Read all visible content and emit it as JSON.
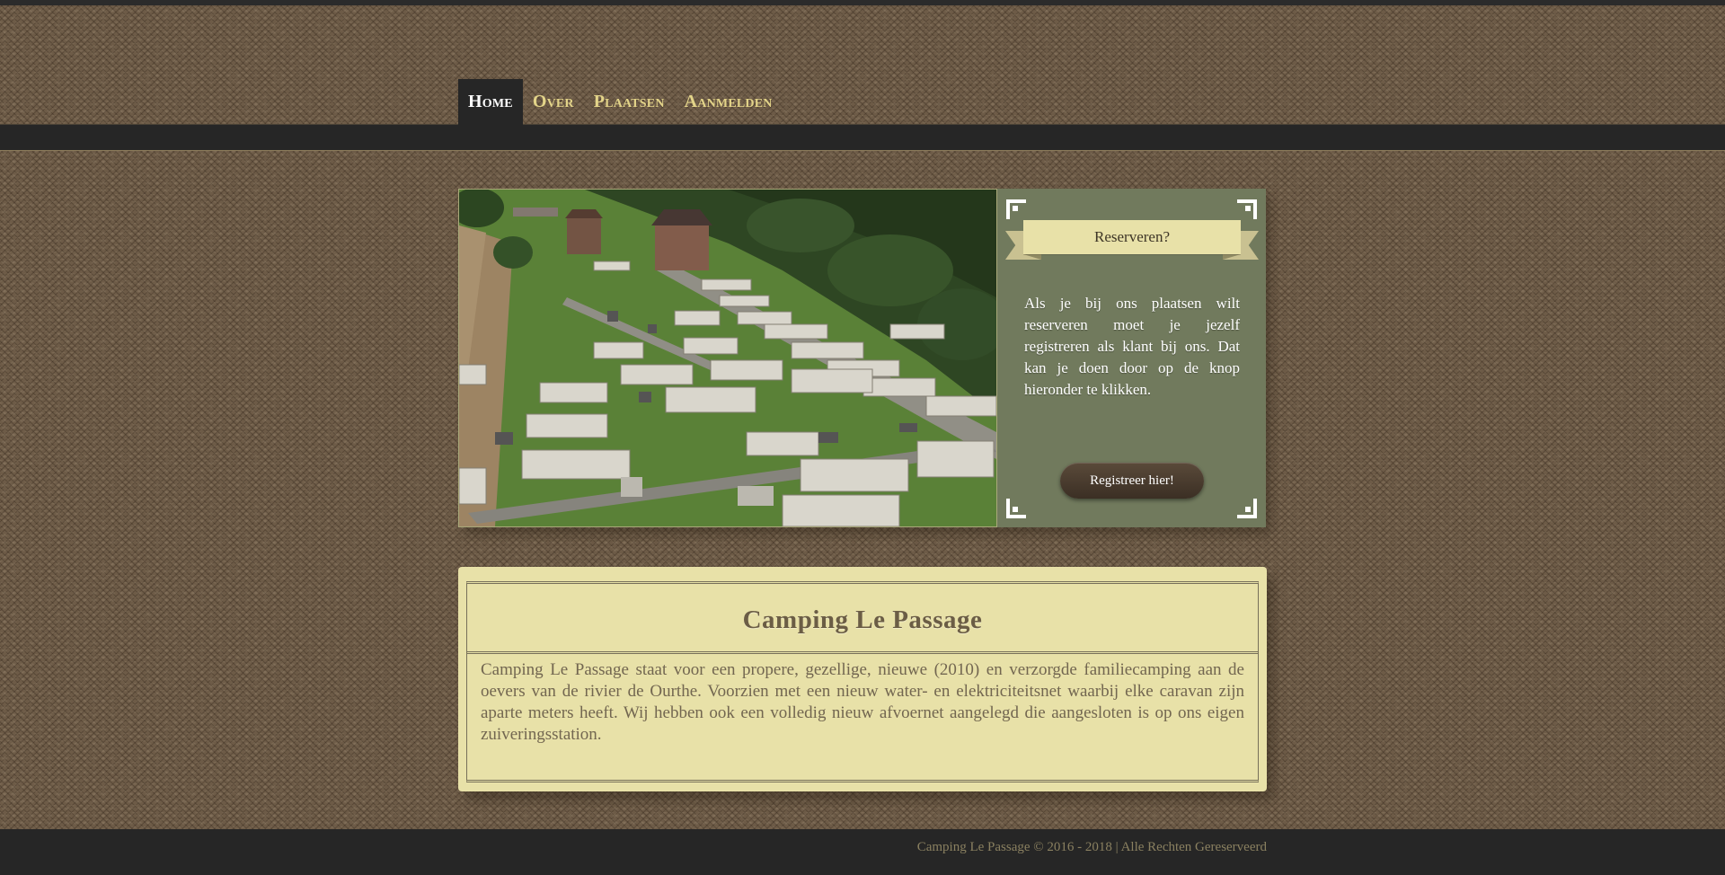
{
  "nav": {
    "items": [
      {
        "label": "Home",
        "active": true
      },
      {
        "label": "Over",
        "active": false
      },
      {
        "label": "Plaatsen",
        "active": false
      },
      {
        "label": "Aanmelden",
        "active": false
      }
    ]
  },
  "promo": {
    "ribbon_title": "Reserveren?",
    "text": "Als je bij ons plaatsen wilt reserveren moet je jezelf registreren als klant bij ons. Dat kan je doen door op de knop hieronder te klikken.",
    "button_label": "Registreer hier!"
  },
  "about": {
    "title": "Camping Le Passage",
    "text": "Camping Le Passage staat voor een propere, gezellige, nieuwe (2010) en verzorgde familiecamping aan de oevers van de rivier de Ourthe. Voorzien met een nieuw water- en elektriciteitsnet waarbij elke caravan zijn aparte meters heeft. Wij hebben ook een volledig nieuw afvoernet aangelegd die aangesloten is op ons eigen zuiveringsstation."
  },
  "footer": {
    "text": "Camping Le Passage © 2016 - 2018 | Alle Rechten Gereserveerd"
  },
  "colors": {
    "background": "#6d5b47",
    "bar": "#262626",
    "accent_gold": "#e3d489",
    "promo_bg": "#717a5d",
    "cream": "#e8e1a8"
  }
}
